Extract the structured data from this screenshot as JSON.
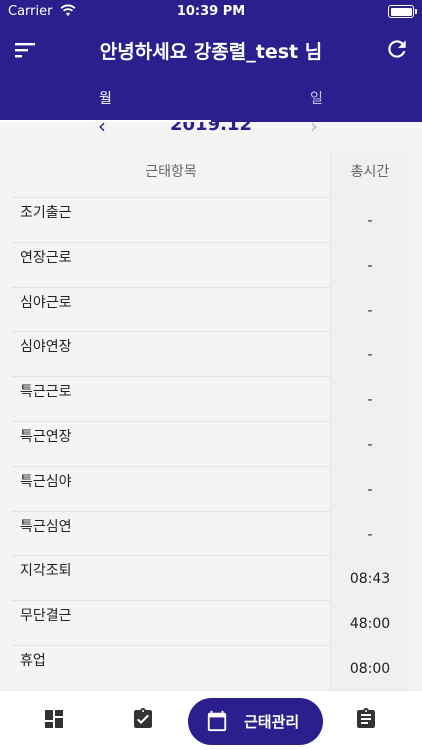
{
  "status_bar": {
    "carrier": "Carrier",
    "time": "10:39 PM"
  },
  "app_bar": {
    "title": "안녕하세요 강종렬_test 님",
    "menu_icon": "sort-menu-icon",
    "refresh_icon": "refresh-icon"
  },
  "tabs": [
    {
      "label": "월",
      "active": true
    },
    {
      "label": "일",
      "active": false
    }
  ],
  "month_nav": {
    "month": "2019.12"
  },
  "table": {
    "headers": {
      "item": "근태항목",
      "total": "총시간"
    },
    "rows": [
      {
        "item": "조기출근",
        "total": "-"
      },
      {
        "item": "연장근로",
        "total": "-"
      },
      {
        "item": "심야근로",
        "total": "-"
      },
      {
        "item": "심야연장",
        "total": "-"
      },
      {
        "item": "특근근로",
        "total": "-"
      },
      {
        "item": "특근연장",
        "total": "-"
      },
      {
        "item": "특근심야",
        "total": "-"
      },
      {
        "item": "특근심연",
        "total": "-"
      },
      {
        "item": "지각조퇴",
        "total": "08:43"
      },
      {
        "item": "무단결근",
        "total": "48:00"
      },
      {
        "item": "휴업",
        "total": "08:00"
      }
    ]
  },
  "bottom_nav": {
    "items": [
      {
        "icon": "dashboard-icon"
      },
      {
        "icon": "clipboard-check-icon"
      },
      {
        "icon": "calendar-icon",
        "label": "근태관리",
        "active": true
      },
      {
        "icon": "clipboard-list-icon"
      }
    ]
  },
  "colors": {
    "primary": "#2a1f8c",
    "background": "#f4f4f4",
    "cell_alt": "#f0f0f0"
  }
}
